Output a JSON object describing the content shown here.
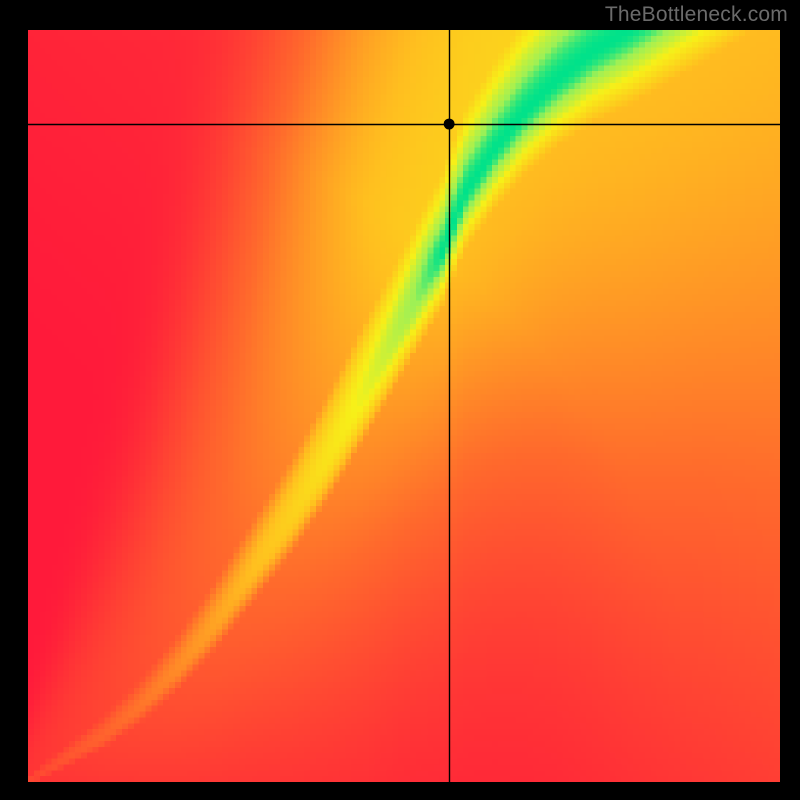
{
  "watermark": "TheBottleneck.com",
  "chart_data": {
    "type": "heatmap",
    "title": "",
    "xlabel": "",
    "ylabel": "",
    "xlim": [
      0,
      1
    ],
    "ylim": [
      0,
      1
    ],
    "grid_n": 128,
    "pixelated": true,
    "ridge": {
      "x": [
        0.0,
        0.05,
        0.1,
        0.15,
        0.2,
        0.25,
        0.3,
        0.35,
        0.4,
        0.45,
        0.5,
        0.55,
        0.58,
        0.62,
        0.66,
        0.7,
        0.75,
        0.8,
        0.9,
        1.0
      ],
      "y": [
        0.0,
        0.03,
        0.06,
        0.1,
        0.15,
        0.21,
        0.28,
        0.35,
        0.43,
        0.52,
        0.61,
        0.7,
        0.78,
        0.84,
        0.89,
        0.93,
        0.97,
        1.0,
        1.07,
        1.15
      ],
      "width": [
        0.005,
        0.01,
        0.015,
        0.02,
        0.026,
        0.032,
        0.038,
        0.044,
        0.05,
        0.056,
        0.06,
        0.066,
        0.07,
        0.074,
        0.078,
        0.082,
        0.088,
        0.094,
        0.105,
        0.12
      ]
    },
    "background_asymmetry": 0.3,
    "marker": {
      "x": 0.56,
      "y": 0.875
    },
    "crosshair": {
      "x": 0.56,
      "y": 0.875
    },
    "color_stops": [
      {
        "t": 0.0,
        "hex": "#ff1a3a"
      },
      {
        "t": 0.3,
        "hex": "#ff6a2c"
      },
      {
        "t": 0.55,
        "hex": "#ffbf1f"
      },
      {
        "t": 0.78,
        "hex": "#f7f018"
      },
      {
        "t": 0.93,
        "hex": "#9ff055"
      },
      {
        "t": 1.0,
        "hex": "#00e28a"
      }
    ]
  }
}
